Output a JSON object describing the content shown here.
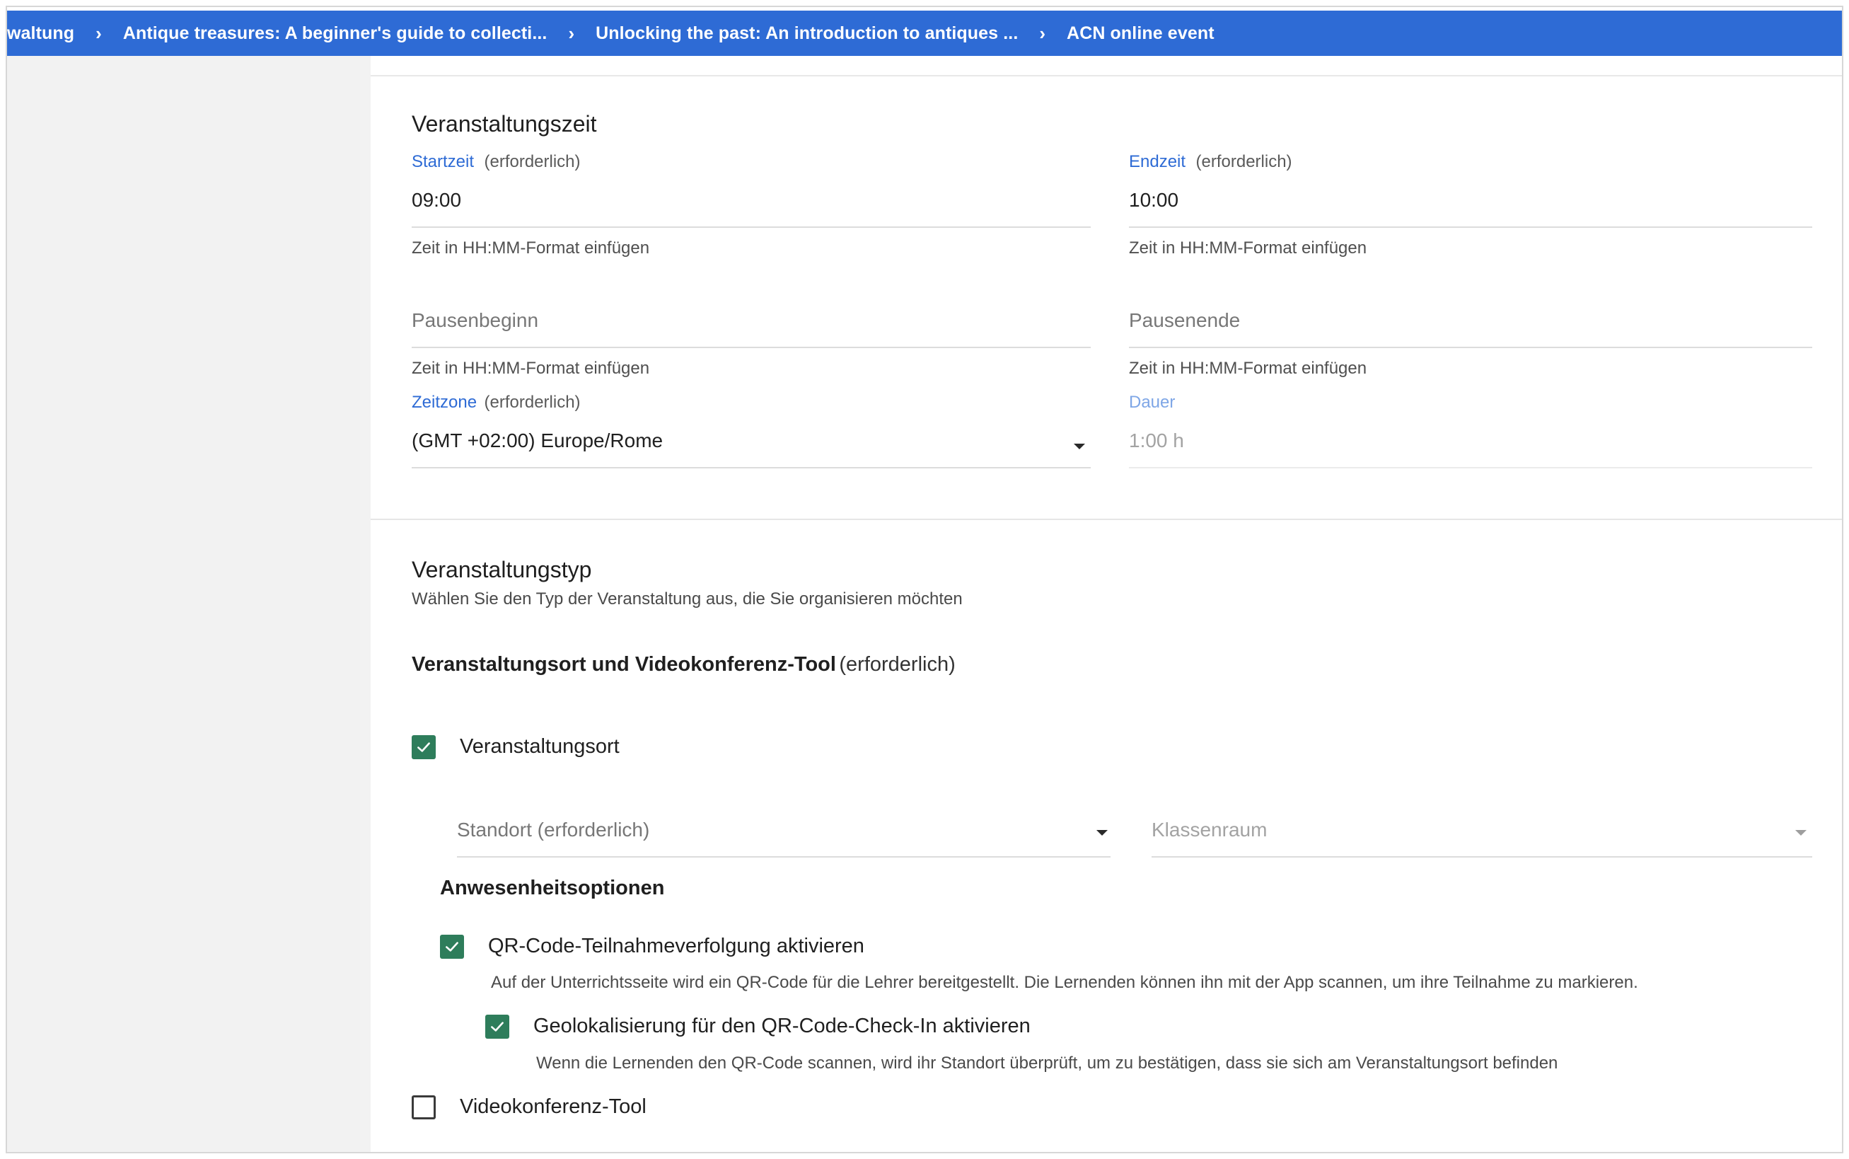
{
  "breadcrumb": {
    "items": [
      "waltung",
      "Antique treasures: A beginner's guide to collecti...",
      "Unlocking the past: An introduction to antiques ...",
      "ACN online event"
    ]
  },
  "event_time": {
    "title": "Veranstaltungszeit",
    "start": {
      "label": "Startzeit",
      "required": "(erforderlich)",
      "value": "09:00",
      "hint": "Zeit in HH:MM-Format einfügen"
    },
    "end": {
      "label": "Endzeit",
      "required": "(erforderlich)",
      "value": "10:00",
      "hint": "Zeit in HH:MM-Format einfügen"
    },
    "break_start": {
      "placeholder": "Pausenbeginn",
      "hint": "Zeit in HH:MM-Format einfügen"
    },
    "break_end": {
      "placeholder": "Pausenende",
      "hint": "Zeit in HH:MM-Format einfügen"
    },
    "timezone": {
      "label": "Zeitzone",
      "required": "(erforderlich)",
      "value": "(GMT +02:00) Europe/Rome"
    },
    "duration": {
      "label": "Dauer",
      "value": "1:00 h"
    }
  },
  "event_type": {
    "title": "Veranstaltungstyp",
    "subtitle": "Wählen Sie den Typ der Veranstaltung aus, die Sie organisieren möchten",
    "location_tool": {
      "label": "Veranstaltungsort und Videokonferenz-Tool",
      "required": "(erforderlich)"
    },
    "venue": {
      "label": "Veranstaltungsort",
      "checked": true
    },
    "location_select": {
      "placeholder": "Standort (erforderlich)"
    },
    "classroom_select": {
      "placeholder": "Klassenraum"
    },
    "attendance": {
      "title": "Anwesenheitsoptionen",
      "qr": {
        "label": "QR-Code-Teilnahmeverfolgung aktivieren",
        "checked": true,
        "description": "Auf der Unterrichtsseite wird ein QR-Code für die Lehrer bereitgestellt. Die Lernenden können ihn mit der App scannen, um ihre Teilnahme zu markieren."
      },
      "geo": {
        "label": "Geolokalisierung für den QR-Code-Check-In aktivieren",
        "checked": true,
        "description": "Wenn die Lernenden den QR-Code scannen, wird ihr Standort überprüft, um zu bestätigen, dass sie sich am Veranstaltungsort befinden"
      }
    },
    "video_tool": {
      "label": "Videokonferenz-Tool",
      "checked": false
    }
  },
  "colors": {
    "accent": "#2e6bd5",
    "checkbox": "#2e7d5b",
    "sidebar": "#f2f2f2"
  }
}
